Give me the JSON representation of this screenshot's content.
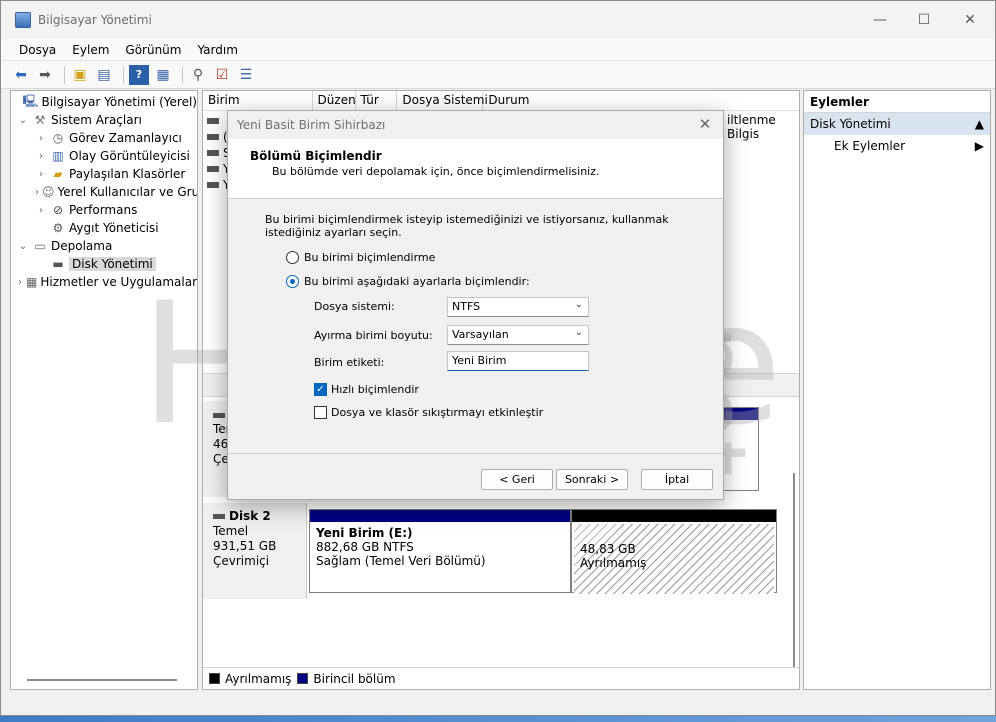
{
  "window": {
    "title": "Bilgisayar Yönetimi",
    "controls": {
      "minimize": "—",
      "maximize": "☐",
      "close": "✕"
    }
  },
  "menu": [
    "Dosya",
    "Eylem",
    "Görünüm",
    "Yardım"
  ],
  "tree": {
    "root": "Bilgisayar Yönetimi (Yerel)",
    "items": [
      {
        "label": "Sistem Araçları",
        "level": 1,
        "expanded": true
      },
      {
        "label": "Görev Zamanlayıcı",
        "level": 2
      },
      {
        "label": "Olay Görüntüleyicisi",
        "level": 2
      },
      {
        "label": "Paylaşılan Klasörler",
        "level": 2
      },
      {
        "label": "Yerel Kullanıcılar ve Gru",
        "level": 2
      },
      {
        "label": "Performans",
        "level": 2
      },
      {
        "label": "Aygıt Yöneticisi",
        "level": 2
      },
      {
        "label": "Depolama",
        "level": 1,
        "expanded": true
      },
      {
        "label": "Disk Yönetimi",
        "level": 2,
        "selected": true
      },
      {
        "label": "Hizmetler ve Uygulamalar",
        "level": 1
      }
    ]
  },
  "volume_columns": [
    "Birim",
    "Düzen",
    "Tür",
    "Dosya Sistemi",
    "Durum"
  ],
  "volume_partial_status": "iltlenme Bilgis",
  "volume_rows": [
    "(",
    "(",
    "S",
    "Y",
    "Y"
  ],
  "disk1": {
    "name_partial": "Temel",
    "size_partial": "465",
    "status_partial": "Çev"
  },
  "disk2": {
    "name": "Disk 2",
    "type": "Temel",
    "size": "931,51 GB",
    "status": "Çevrimiçi",
    "partition1": {
      "name": "Yeni Birim  (E:)",
      "size": "882,68 GB NTFS",
      "status": "Sağlam (Temel Veri Bölümü)"
    },
    "partition2": {
      "size": "48,83 GB",
      "status": "Ayrılmamış"
    }
  },
  "legend": {
    "unallocated": "Ayrılmamış",
    "primary": "Birincil bölüm"
  },
  "actions": {
    "header": "Eylemler",
    "section": "Disk Yönetimi",
    "item": "Ek Eylemler"
  },
  "watermark": {
    "main": "HeBeLe",
    "suffix": ".net"
  },
  "dialog": {
    "title": "Yeni Basit Birim Sihirbazı",
    "heading": "Bölümü Biçimlendir",
    "subheading": "Bu bölümde veri depolamak için, önce biçimlendirmelisiniz.",
    "intro": "Bu birimi biçimlendirmek isteyip istemediğinizi ve istiyorsanız, kullanmak istediğiniz ayarları seçin.",
    "radio_no_format": "Bu birimi biçimlendirme",
    "radio_format": "Bu birimi aşağıdaki ayarlarla biçimlendir:",
    "fs_label": "Dosya sistemi:",
    "fs_value": "NTFS",
    "alloc_label": "Ayırma birimi boyutu:",
    "alloc_value": "Varsayılan",
    "vol_label_label": "Birim etiketi:",
    "vol_label_value": "Yeni Birim",
    "quick_format": "Hızlı biçimlendir",
    "compression": "Dosya ve klasör sıkıştırmayı etkinleştir",
    "back": "< Geri",
    "next": "Sonraki >",
    "cancel": "İptal"
  },
  "colors": {
    "primary_partition": "#000080",
    "unallocated": "#000000",
    "accent": "#0067c0"
  }
}
